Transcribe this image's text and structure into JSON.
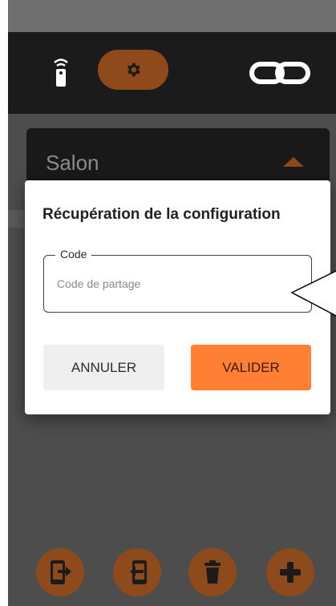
{
  "header": {
    "remote_icon": "remote-control-icon",
    "settings_icon": "gear-icon",
    "link_icon": "link-icon"
  },
  "room": {
    "label": "Salon"
  },
  "dialog": {
    "title": "Récupération de la configuration",
    "field_label": "Code",
    "field_placeholder": "Code de partage",
    "field_value": "",
    "cancel_label": "ANNULER",
    "confirm_label": "VALIDER"
  },
  "actions": [
    "export-phone-icon",
    "import-phone-icon",
    "trash-icon",
    "add-icon"
  ],
  "colors": {
    "accent": "#ff7f35",
    "accent_dim": "#8f4a1c",
    "topbar": "#1b1b1b"
  }
}
